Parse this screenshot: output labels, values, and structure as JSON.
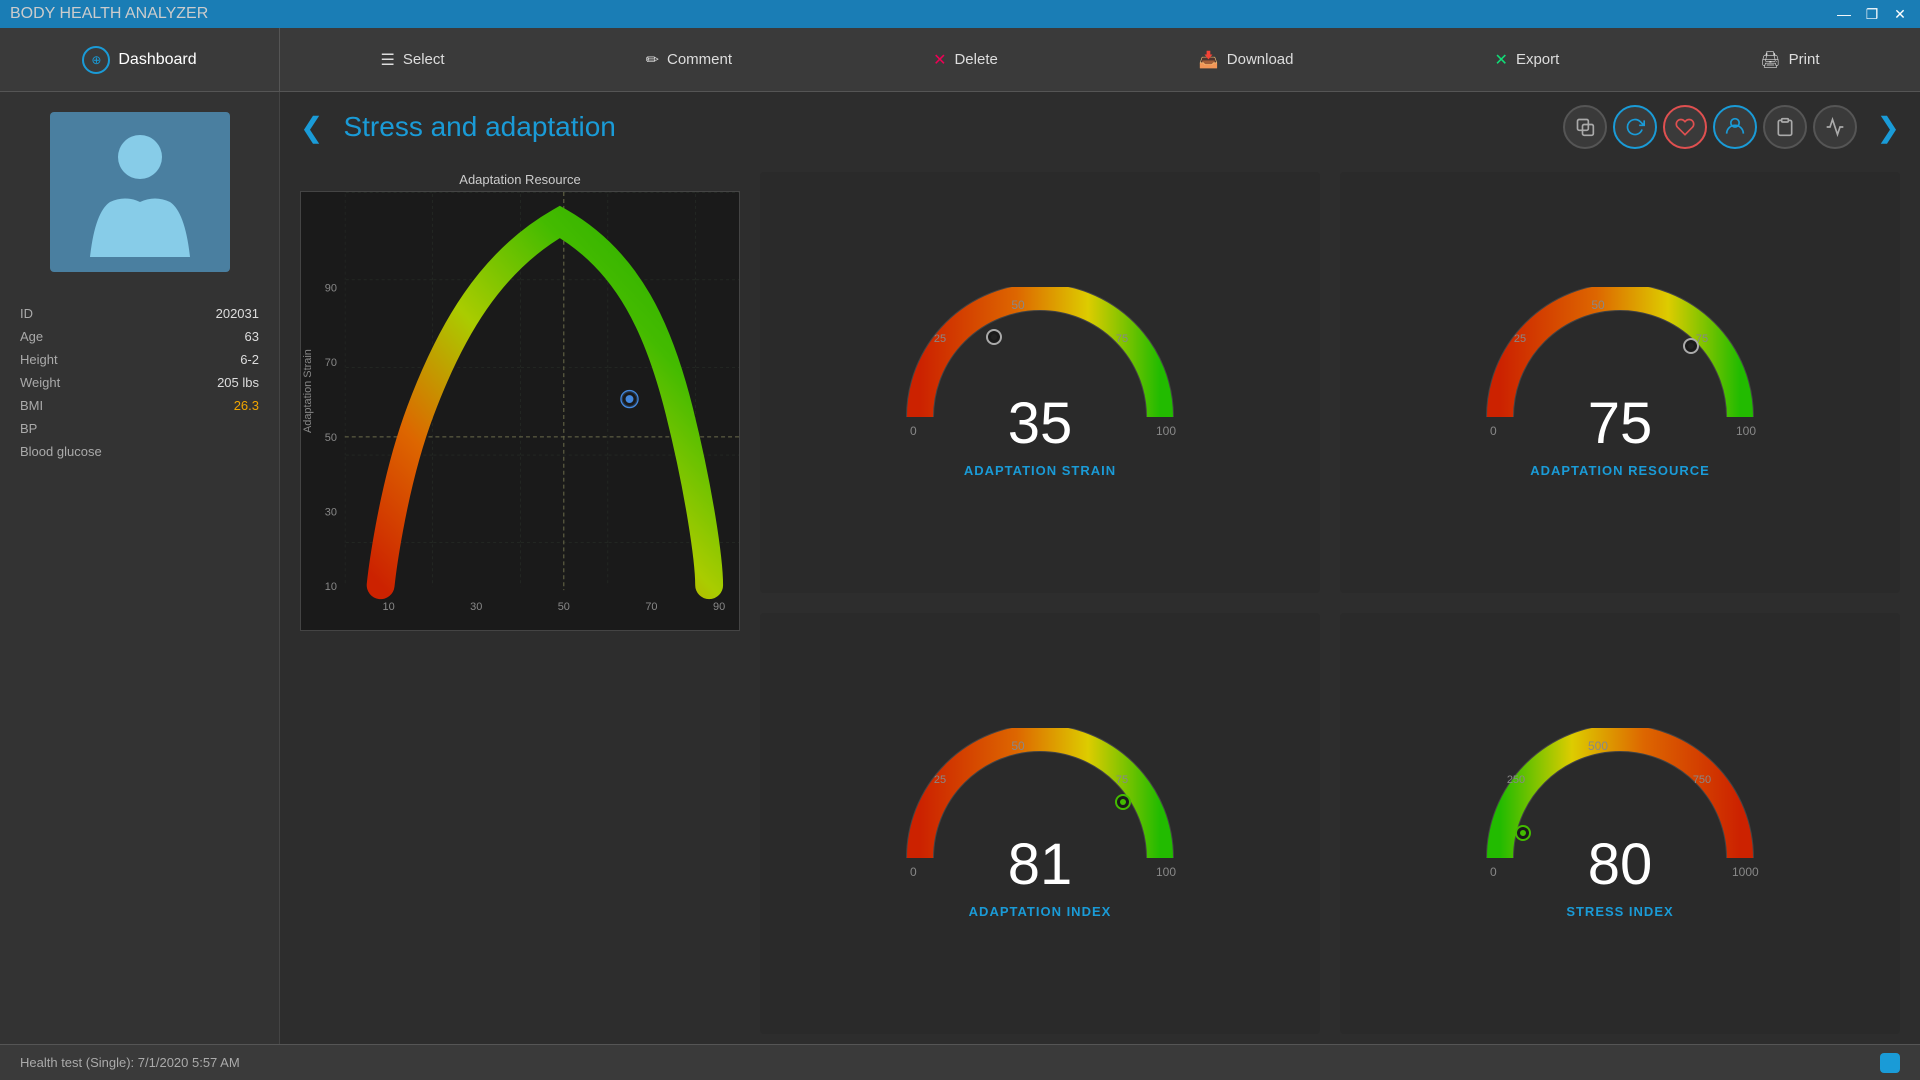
{
  "app": {
    "title": "BODY HEALTH ANALYZER"
  },
  "titlebar": {
    "title": "BODY HEALTH ANALYZER",
    "minimize": "—",
    "restore": "❐",
    "close": "✕"
  },
  "navbar": {
    "brand": "Dashboard",
    "items": [
      {
        "id": "select",
        "icon": "☰",
        "label": "Select"
      },
      {
        "id": "comment",
        "icon": "✏",
        "label": "Comment"
      },
      {
        "id": "delete",
        "icon": "✕",
        "label": "Delete"
      },
      {
        "id": "download",
        "icon": "⬇",
        "label": "Download"
      },
      {
        "id": "export",
        "icon": "X",
        "label": "Export"
      },
      {
        "id": "print",
        "icon": "🖨",
        "label": "Print"
      }
    ]
  },
  "page": {
    "title": "Stress and adaptation",
    "back_arrow": "❮",
    "forward_arrow": "❯"
  },
  "patient": {
    "id_label": "ID",
    "id_value": "202031",
    "age_label": "Age",
    "age_value": "63",
    "height_label": "Height",
    "height_value": "6-2",
    "weight_label": "Weight",
    "weight_value": "205 lbs",
    "bmi_label": "BMI",
    "bmi_value": "26.3",
    "bp_label": "BP",
    "bp_value": "",
    "blood_glucose_label": "Blood glucose",
    "blood_glucose_value": ""
  },
  "chart": {
    "title": "Adaptation Resource",
    "y_label": "Adaptation Strain",
    "x_axis": [
      "10",
      "30",
      "50",
      "70",
      "90"
    ],
    "y_axis": [
      "10",
      "30",
      "50",
      "70",
      "90"
    ]
  },
  "gauges": [
    {
      "id": "adaptation_strain",
      "label": "ADAPTATION STRAIN",
      "value": "35",
      "min": "0",
      "max": "100",
      "scale_25": "25",
      "scale_50": "50",
      "scale_75": "75",
      "needle_angle": -60
    },
    {
      "id": "adaptation_resource",
      "label": "ADAPTATION RESOURCE",
      "value": "75",
      "min": "0",
      "max": "100",
      "scale_25": "25",
      "scale_50": "50",
      "scale_75": "75",
      "needle_angle": 30
    },
    {
      "id": "adaptation_index",
      "label": "ADAPTATION INDEX",
      "value": "81",
      "min": "0",
      "max": "100",
      "scale_25": "25",
      "scale_50": "50",
      "scale_75": "75",
      "needle_angle": 38
    },
    {
      "id": "stress_index",
      "label": "STRESS INDEX",
      "value": "80",
      "min": "0",
      "max": "1000",
      "scale_250": "250",
      "scale_500": "500",
      "scale_750": "750",
      "needle_angle": -62
    }
  ],
  "statusbar": {
    "text": "Health test (Single):  7/1/2020 5:57 AM"
  }
}
